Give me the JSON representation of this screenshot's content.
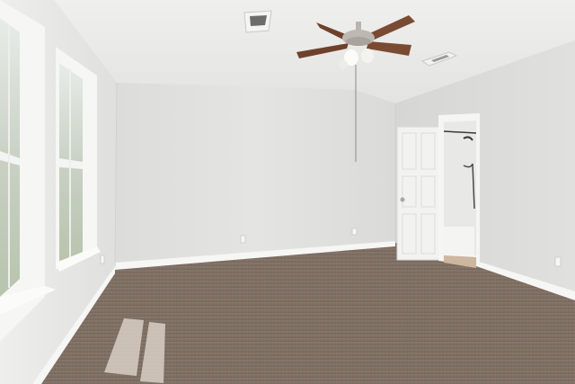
{
  "scene": {
    "subject": "empty-bedroom-interior",
    "colors": {
      "ceiling": "#e9e9e8",
      "back_wall": "#e0e0df",
      "left_wall": "#e6e6e5",
      "right_wall": "#d9d9d8",
      "carpet": "#7d6d62",
      "baseboard": "#f4f4f2",
      "window_frame": "#f6f6f5",
      "door": "#f2f2f1",
      "fan_blade": "#7a4a32",
      "fan_metal": "#b9b5ae"
    },
    "objects": {
      "ceiling_fan": "ceiling-fan",
      "windows": "double-hung-windows",
      "door": "open-six-panel-door",
      "bathroom": "bathroom-doorway",
      "vents": "air-vent",
      "outlets": "wall-outlet"
    }
  }
}
